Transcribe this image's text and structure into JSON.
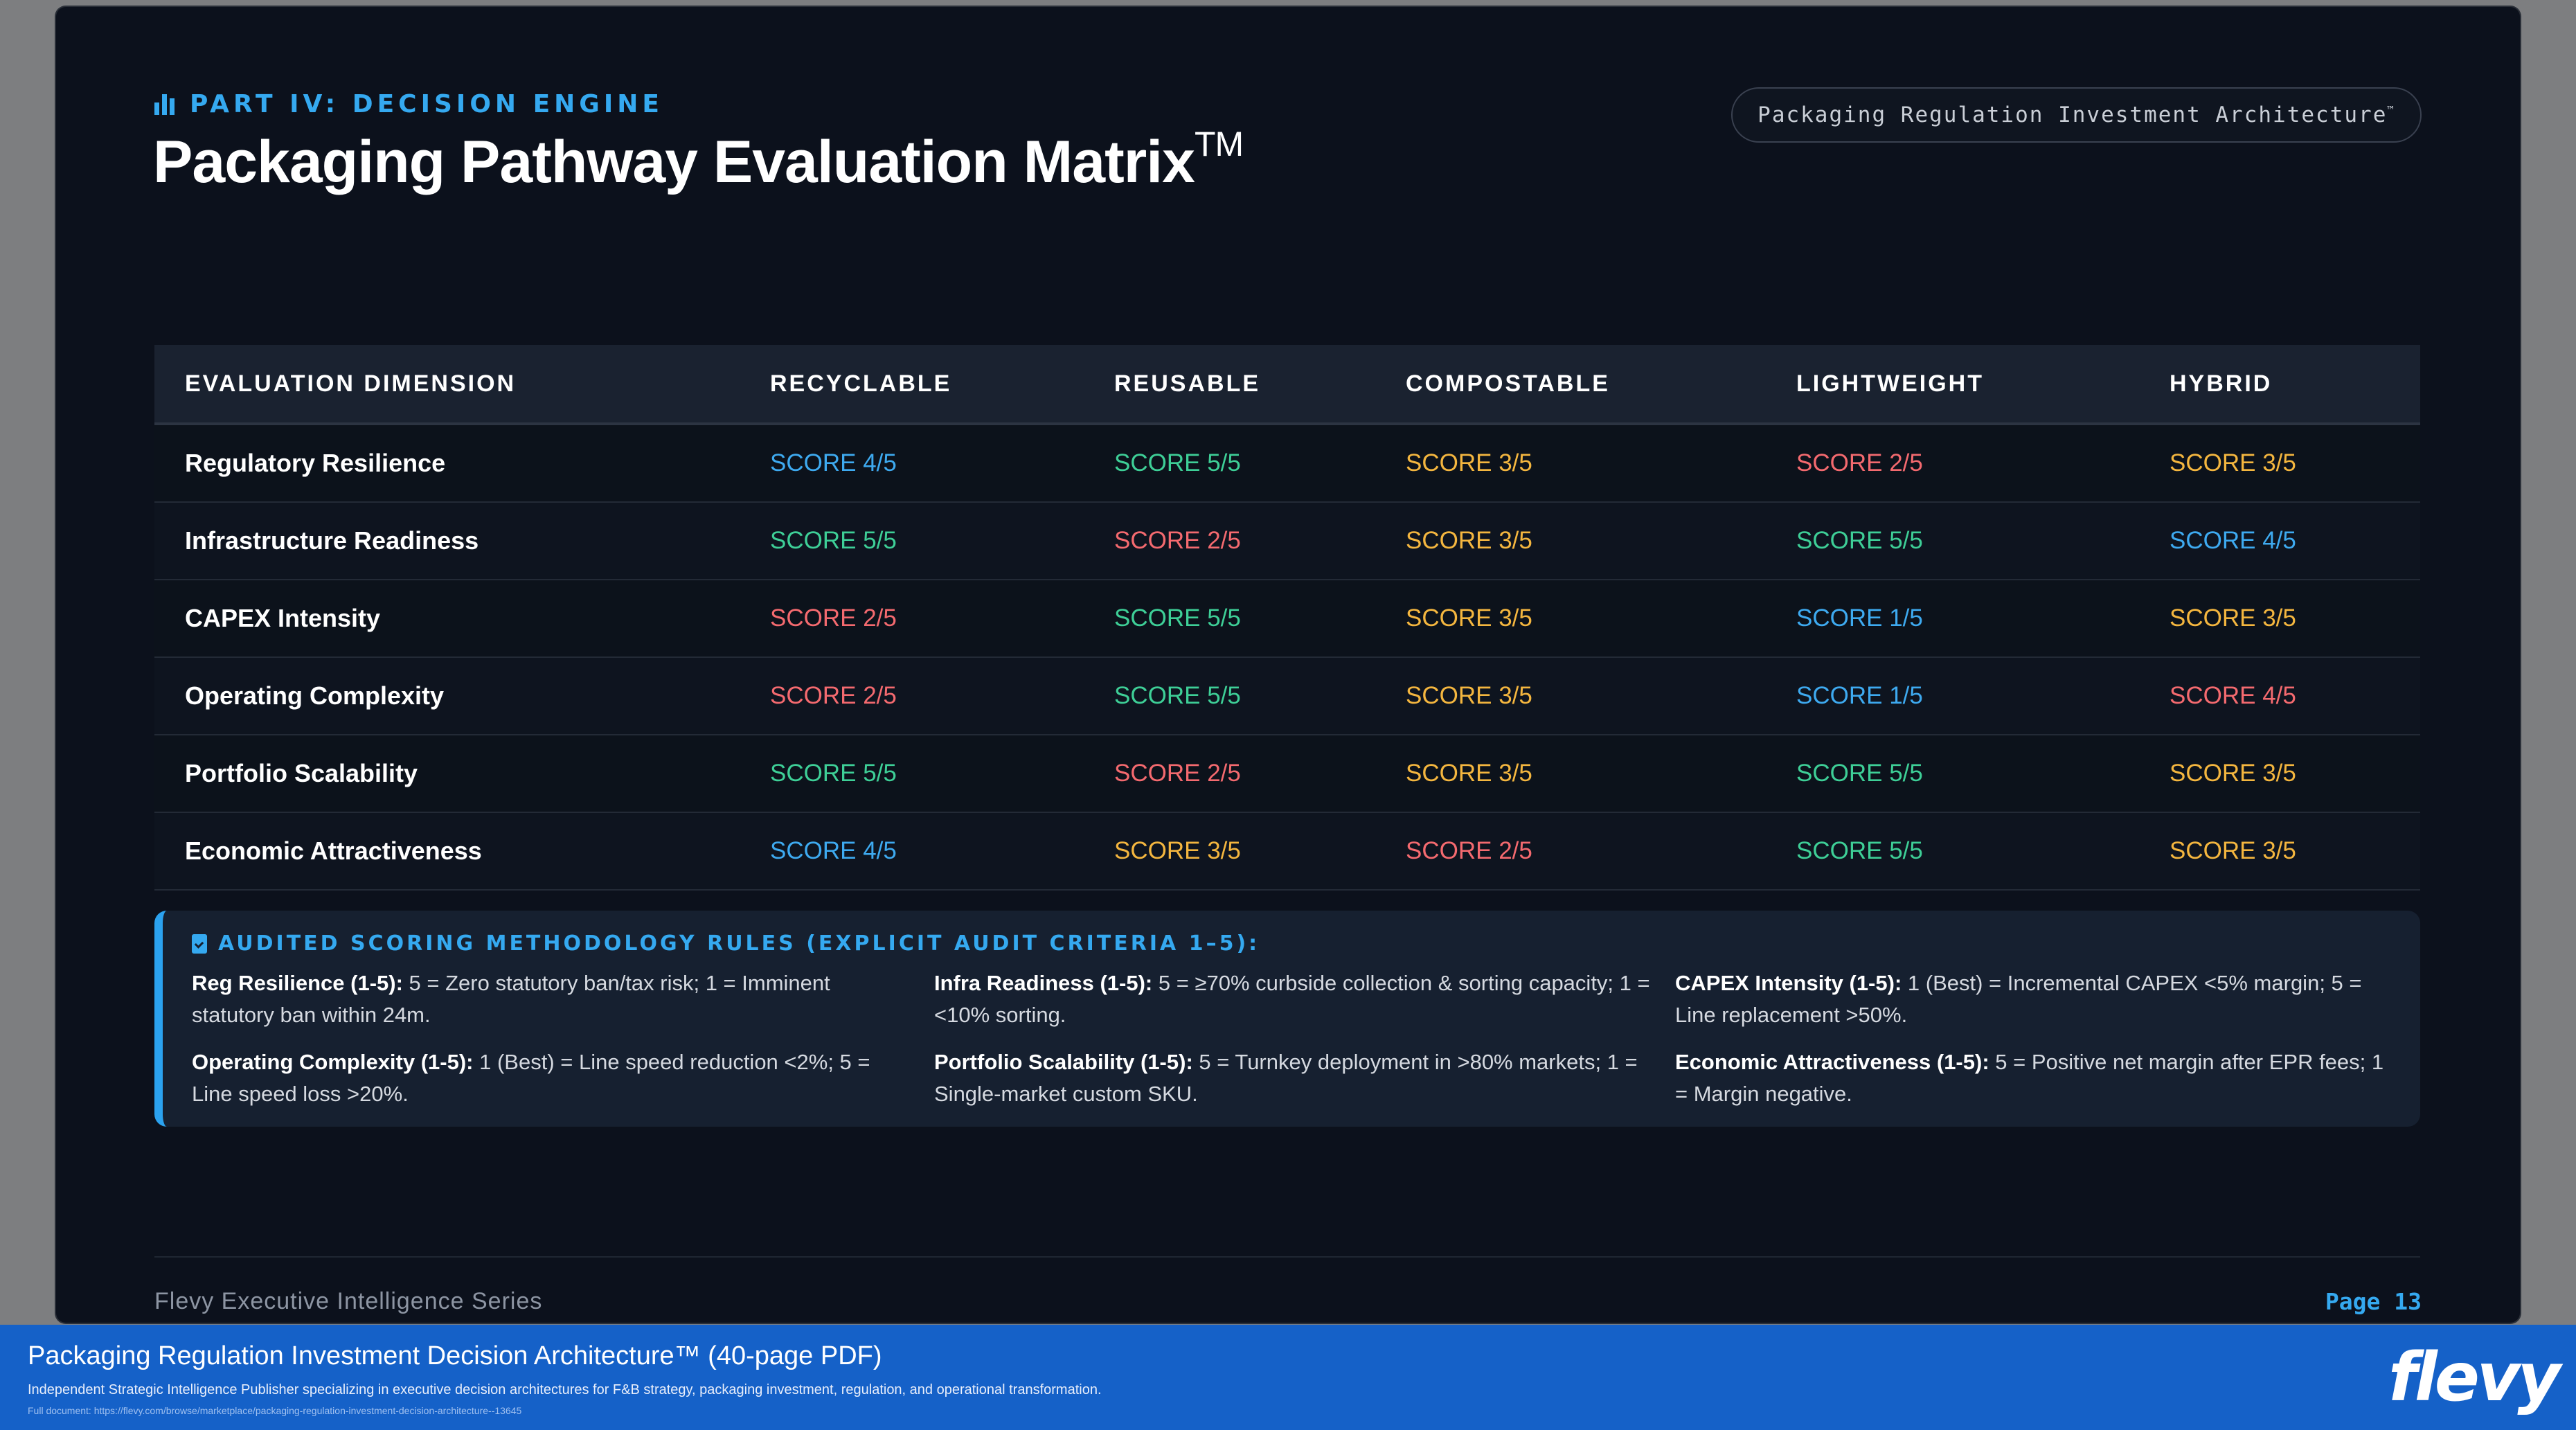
{
  "header": {
    "section_label": "PART IV: DECISION ENGINE",
    "title": "Packaging Pathway Evaluation Matrix",
    "title_mark": "TM",
    "pill_text": "Packaging Regulation Investment Architecture",
    "pill_mark": "™"
  },
  "colors": {
    "accent": "#35a9f0",
    "score_5": "#3ecf97",
    "score_4": "#3eaaf0",
    "score_3": "#f4b63f",
    "score_2": "#f46a6f",
    "score_1": "#3eaaf0",
    "score_4_alt": "#f46a6f"
  },
  "matrix": {
    "headers": [
      "EVALUATION DIMENSION",
      "RECYCLABLE",
      "REUSABLE",
      "COMPOSTABLE",
      "LIGHTWEIGHT",
      "HYBRID"
    ],
    "rows": [
      {
        "dimension": "Regulatory Resilience",
        "cells": [
          {
            "text": "SCORE 4/5",
            "color": "#3eaaf0"
          },
          {
            "text": "SCORE 5/5",
            "color": "#3ecf97"
          },
          {
            "text": "SCORE 3/5",
            "color": "#f4b63f"
          },
          {
            "text": "SCORE 2/5",
            "color": "#f46a6f"
          },
          {
            "text": "SCORE 3/5",
            "color": "#f4b63f"
          }
        ]
      },
      {
        "dimension": "Infrastructure Readiness",
        "cells": [
          {
            "text": "SCORE 5/5",
            "color": "#3ecf97"
          },
          {
            "text": "SCORE 2/5",
            "color": "#f46a6f"
          },
          {
            "text": "SCORE 3/5",
            "color": "#f4b63f"
          },
          {
            "text": "SCORE 5/5",
            "color": "#3ecf97"
          },
          {
            "text": "SCORE 4/5",
            "color": "#3eaaf0"
          }
        ]
      },
      {
        "dimension": "CAPEX Intensity",
        "cells": [
          {
            "text": "SCORE 2/5",
            "color": "#f46a6f"
          },
          {
            "text": "SCORE 5/5",
            "color": "#3ecf97"
          },
          {
            "text": "SCORE 3/5",
            "color": "#f4b63f"
          },
          {
            "text": "SCORE 1/5",
            "color": "#3eaaf0"
          },
          {
            "text": "SCORE 3/5",
            "color": "#f4b63f"
          }
        ]
      },
      {
        "dimension": "Operating Complexity",
        "cells": [
          {
            "text": "SCORE 2/5",
            "color": "#f46a6f"
          },
          {
            "text": "SCORE 5/5",
            "color": "#3ecf97"
          },
          {
            "text": "SCORE 3/5",
            "color": "#f4b63f"
          },
          {
            "text": "SCORE 1/5",
            "color": "#3eaaf0"
          },
          {
            "text": "SCORE 4/5",
            "color": "#f46a6f"
          }
        ]
      },
      {
        "dimension": "Portfolio Scalability",
        "cells": [
          {
            "text": "SCORE 5/5",
            "color": "#3ecf97"
          },
          {
            "text": "SCORE 2/5",
            "color": "#f46a6f"
          },
          {
            "text": "SCORE 3/5",
            "color": "#f4b63f"
          },
          {
            "text": "SCORE 5/5",
            "color": "#3ecf97"
          },
          {
            "text": "SCORE 3/5",
            "color": "#f4b63f"
          }
        ]
      },
      {
        "dimension": "Economic Attractiveness",
        "cells": [
          {
            "text": "SCORE 4/5",
            "color": "#3eaaf0"
          },
          {
            "text": "SCORE 3/5",
            "color": "#f4b63f"
          },
          {
            "text": "SCORE 2/5",
            "color": "#f46a6f"
          },
          {
            "text": "SCORE 5/5",
            "color": "#3ecf97"
          },
          {
            "text": "SCORE 3/5",
            "color": "#f4b63f"
          }
        ]
      }
    ]
  },
  "rules": {
    "heading": "AUDITED SCORING METHODOLOGY RULES (EXPLICIT AUDIT CRITERIA 1–5):",
    "items": [
      {
        "label": "Reg Resilience (1-5):",
        "text": " 5 = Zero statutory ban/tax risk; 1 = Imminent statutory ban within 24m."
      },
      {
        "label": "Infra Readiness (1-5):",
        "text": " 5 = ≥70% curbside collection & sorting capacity; 1 = <10% sorting."
      },
      {
        "label": "CAPEX Intensity (1-5):",
        "text": " 1 (Best) = Incremental CAPEX <5% margin; 5 = Line replacement >50%."
      },
      {
        "label": "Operating Complexity (1-5):",
        "text": " 1 (Best) = Line speed reduction <2%; 5 = Line speed loss >20%."
      },
      {
        "label": "Portfolio Scalability (1-5):",
        "text": " 5 = Turnkey deployment in >80% markets; 1 = Single-market custom SKU."
      },
      {
        "label": "Economic Attractiveness (1-5):",
        "text": " 5 = Positive net margin after EPR fees; 1 = Margin negative."
      }
    ]
  },
  "footer": {
    "series": "Flevy Executive Intelligence Series",
    "page": "Page  13"
  },
  "banner": {
    "title": "Packaging Regulation Investment Decision Architecture™",
    "title_suffix": " (40-page PDF)",
    "subtitle": "Independent Strategic Intelligence Publisher specializing in executive decision architectures for F&B strategy, packaging investment, regulation, and operational transformation.",
    "link": "Full document: https://flevy.com/browse/marketplace/packaging-regulation-investment-decision-architecture--13645",
    "logo": "flevy"
  }
}
